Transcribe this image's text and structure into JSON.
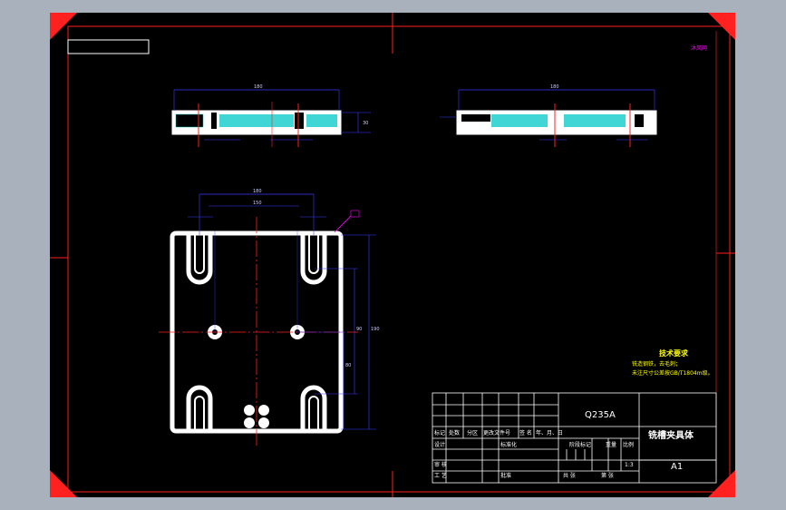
{
  "drawing": {
    "material": "Q235A",
    "part_name": "铣槽夹具体",
    "sheet_size": "A1",
    "scale": "1:3",
    "logo_text": "沐风网",
    "tech_req": {
      "heading": "技术要求",
      "line1": "铣造钢铁，去毛刺；",
      "line2": "未注尺寸公差按GB/T1804m级。"
    },
    "title_block": {
      "row_labels": [
        "标记",
        "处数",
        "分区",
        "更改文件号",
        "签 名",
        "年、月、日"
      ],
      "design": "设计",
      "standardize": "标准化",
      "review": "审 核",
      "process": "工 艺",
      "approve": "批准",
      "stage_mark": "阶段标记",
      "weight": "重量",
      "ratio": "比例",
      "sheets_total": "共   张",
      "sheet_no": "第   张"
    },
    "dimensions": {
      "top_view_width": "180",
      "top_view_height": "30",
      "side_view_width": "180",
      "plate_width": "180",
      "plate_inner": "150",
      "plate_height": "190",
      "slot_depth": "80",
      "hole_spacing": "90"
    }
  },
  "colors": {
    "background": "#a9b1bd",
    "sheet": "#000000",
    "border": "#ff0000",
    "geometry": "#ffffff",
    "dimension": "#3b3bff",
    "hatch": "#00c8c8",
    "text_yellow": "#ffff00",
    "logo": "#ff00ff"
  }
}
